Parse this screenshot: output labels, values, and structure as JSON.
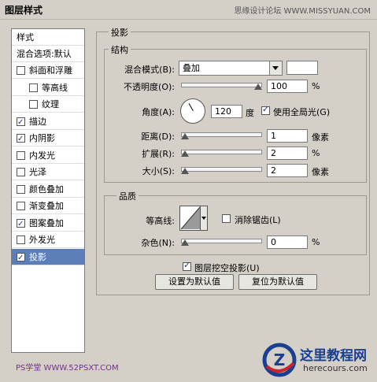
{
  "window": {
    "title": "图层样式",
    "watermark": "思缘设计论坛 WWW.MISSYUAN.COM"
  },
  "sidebar": {
    "head1": "样式",
    "head2": "混合选项:默认",
    "items": [
      {
        "label": "斜面和浮雕",
        "checked": false,
        "indent": false
      },
      {
        "label": "等高线",
        "checked": false,
        "indent": true
      },
      {
        "label": "纹理",
        "checked": false,
        "indent": true
      },
      {
        "label": "描边",
        "checked": true,
        "indent": false
      },
      {
        "label": "内阴影",
        "checked": true,
        "indent": false
      },
      {
        "label": "内发光",
        "checked": false,
        "indent": false
      },
      {
        "label": "光泽",
        "checked": false,
        "indent": false
      },
      {
        "label": "颜色叠加",
        "checked": false,
        "indent": false
      },
      {
        "label": "渐变叠加",
        "checked": false,
        "indent": false
      },
      {
        "label": "图案叠加",
        "checked": true,
        "indent": false
      },
      {
        "label": "外发光",
        "checked": false,
        "indent": false
      },
      {
        "label": "投影",
        "checked": true,
        "indent": false,
        "selected": true
      }
    ]
  },
  "panel": {
    "title": "投影",
    "structure": {
      "title": "结构",
      "blend_label": "混合模式(B):",
      "blend_value": "叠加",
      "opacity_label": "不透明度(O):",
      "opacity_value": "100",
      "opacity_unit": "%",
      "opacity_level": 1.0,
      "angle_label": "角度(A):",
      "angle_value": "120",
      "angle_unit": "度",
      "global_light_label": "使用全局光(G)",
      "global_light_checked": true,
      "distance_label": "距离(D):",
      "distance_value": "1",
      "distance_unit": "像素",
      "distance_level": 0.0,
      "spread_label": "扩展(R):",
      "spread_value": "2",
      "spread_unit": "%",
      "spread_level": 0.0,
      "size_label": "大小(S):",
      "size_value": "2",
      "size_unit": "像素",
      "size_level": 0.0
    },
    "quality": {
      "title": "品质",
      "contour_label": "等高线:",
      "antialias_label": "消除锯齿(L)",
      "antialias_checked": false,
      "noise_label": "杂色(N):",
      "noise_value": "0",
      "noise_unit": "%",
      "noise_level": 0.0
    },
    "knockout_label": "图层挖空投影(U)",
    "knockout_checked": true,
    "make_default_label": "设置为默认值",
    "reset_default_label": "复位为默认值"
  },
  "footer": {
    "watermark_left": "PS学堂 WWW.52PSXT.COM",
    "logo_text": "这里教程网",
    "logo_url": "herecours.com",
    "logo_letter": "Z"
  },
  "colors": {
    "selection": "#5d7fb9",
    "panel_bg": "#d4d0c8",
    "logo_blue": "#1b3f8f",
    "logo_red": "#c7242c"
  }
}
